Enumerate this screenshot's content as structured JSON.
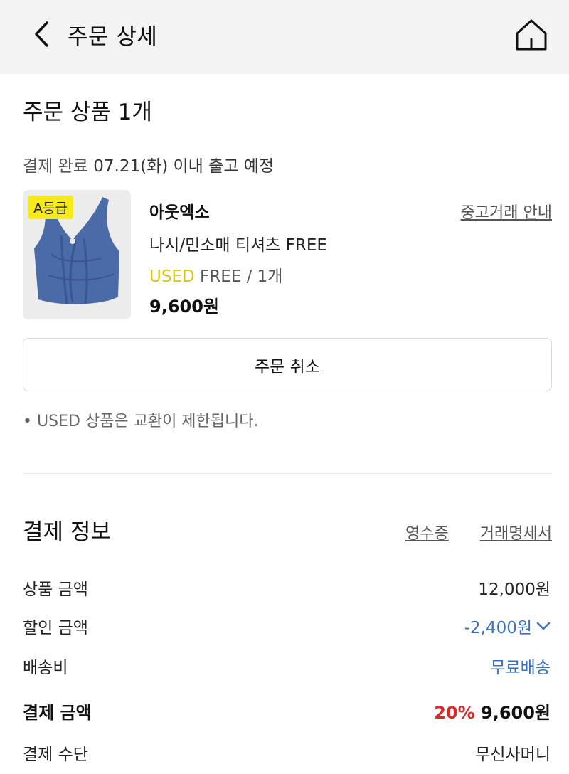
{
  "header": {
    "title": "주문 상세",
    "back_icon": "chevron-left-icon",
    "home_icon": "home-icon"
  },
  "order": {
    "section_title": "주문 상품 1개",
    "delivery_status": "결제 완료",
    "delivery_schedule": "07.21(화) 이내 출고 예정"
  },
  "product": {
    "grade_badge": "A등급",
    "brand": "아웃엑소",
    "used_guide_link": "중고거래 안내",
    "name": "나시/민소매 티셔츠 FREE",
    "used_tag": "USED",
    "option": "FREE / 1개",
    "price": "9,600원"
  },
  "actions": {
    "cancel_label": "주문 취소"
  },
  "notice": {
    "text": "•  USED 상품은 교환이 제한됩니다."
  },
  "payment": {
    "section_title": "결제 정보",
    "receipt_link": "영수증",
    "statement_link": "거래명세서",
    "product_amount_label": "상품 금액",
    "product_amount_value": "12,000원",
    "discount_label": "할인 금액",
    "discount_value": "-2,400원",
    "shipping_label": "배송비",
    "shipping_value": "무료배송",
    "total_label": "결제 금액",
    "total_discount_rate": "20%",
    "total_value": "9,600원",
    "method_label": "결제 수단",
    "method_value": "무신사머니"
  },
  "colors": {
    "header_bg": "#f3f3f3",
    "used_yellow": "#d8c51c",
    "badge_yellow": "#f6ea1a",
    "link_blue": "#3a6fc0",
    "discount_red": "#d62b2b",
    "product_blue": "#4a6aa8"
  }
}
